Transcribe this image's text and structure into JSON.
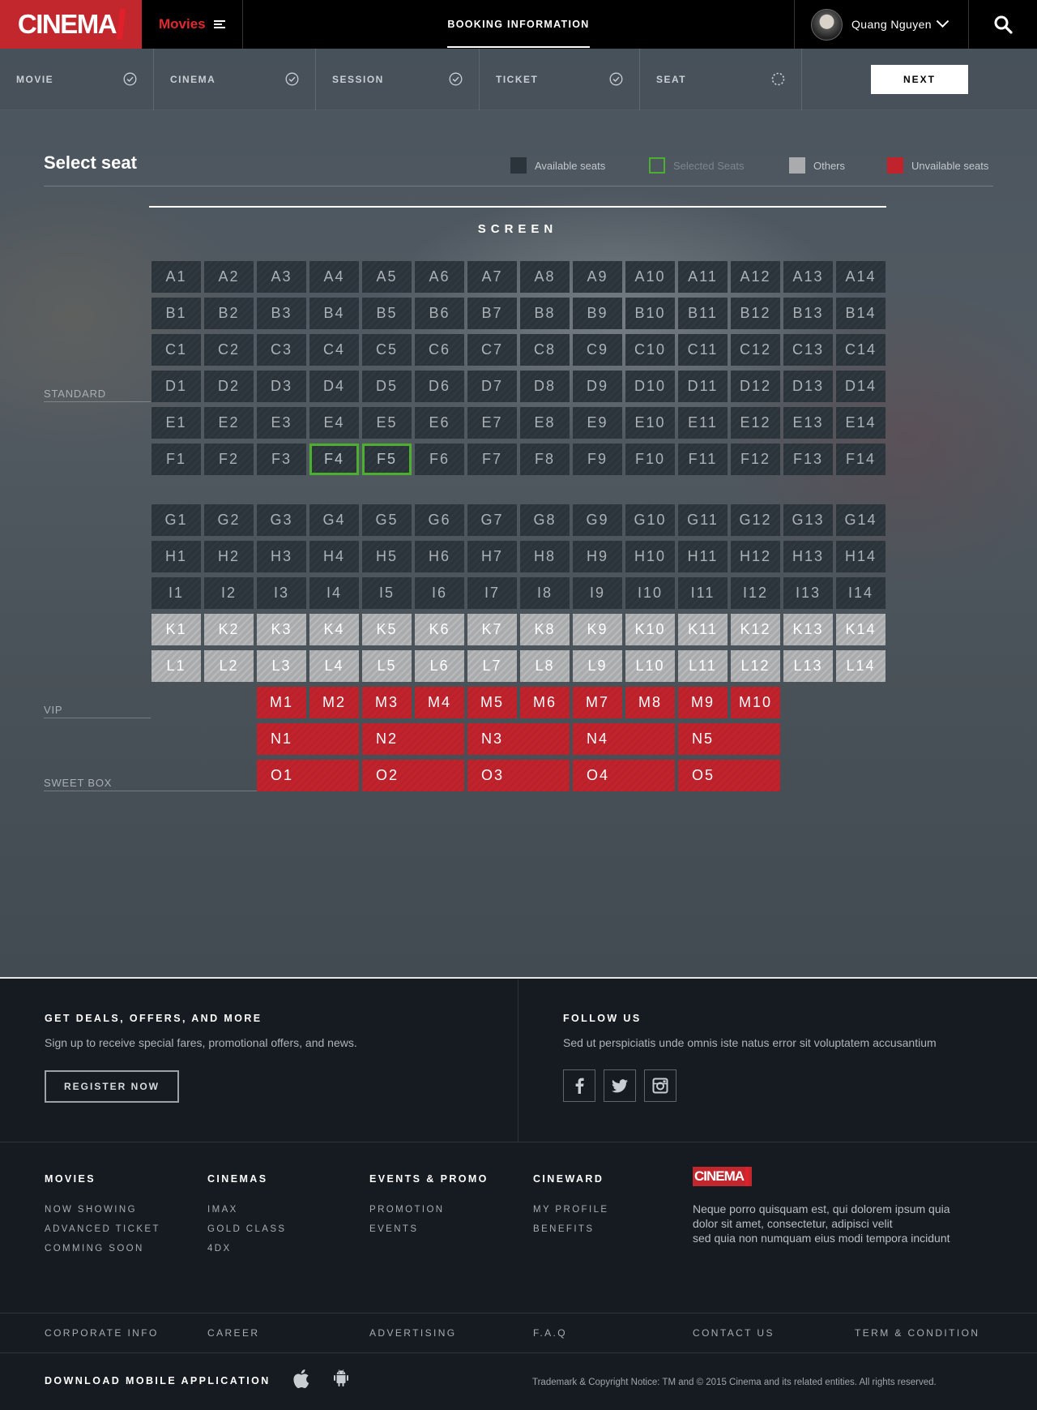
{
  "brand": {
    "logo_text": "CINEMA"
  },
  "topbar": {
    "movies_label": "Movies",
    "nav_title": "BOOKING INFORMATION",
    "user_name": "Quang Nguyen",
    "icons": {
      "menu": "hamburger-icon",
      "dropdown": "chevron-down-icon",
      "search": "search-icon"
    }
  },
  "steps": {
    "items": [
      {
        "label": "MOVIE",
        "status": "done"
      },
      {
        "label": "CINEMA",
        "status": "done"
      },
      {
        "label": "SESSION",
        "status": "done"
      },
      {
        "label": "TICKET",
        "status": "done"
      },
      {
        "label": "SEAT",
        "status": "in-progress"
      }
    ],
    "next_label": "NEXT"
  },
  "seat_map": {
    "title": "Select seat",
    "legend": [
      {
        "label": "Available seats",
        "color": "#2c343b"
      },
      {
        "label": "Selected Seats",
        "color": "#4caf2f"
      },
      {
        "label": "Others",
        "color": "#a9abad"
      },
      {
        "label": "Unvailable seats",
        "color": "#c1232d"
      }
    ],
    "screen_label": "SCREEN",
    "sections": {
      "standard": "STANDARD",
      "vip": "VIP",
      "sweetbox": "SWEET BOX"
    },
    "standard_rows": [
      "A",
      "B",
      "C",
      "D",
      "E",
      "F"
    ],
    "vip_rows_available": [
      "G",
      "H",
      "I"
    ],
    "vip_rows_others": [
      "K",
      "L"
    ],
    "row_count": 14,
    "selected": [
      "F4",
      "F5"
    ],
    "unavailable_row": {
      "row": "M",
      "count": 10
    },
    "sweetbox_rows": [
      {
        "row": "N",
        "count": 5
      },
      {
        "row": "O",
        "count": 5
      }
    ]
  },
  "footer": {
    "deals": {
      "heading": "GET DEALS, OFFERS, AND MORE",
      "text": "Sign up to receive special fares, promotional offers, and news.",
      "button": "REGISTER NOW"
    },
    "follow": {
      "heading": "FOLLOW US",
      "text": "Sed ut perspiciatis unde omnis iste natus error sit voluptatem accusantium",
      "icons": [
        "facebook-icon",
        "twitter-icon",
        "instagram-icon"
      ]
    },
    "columns": [
      {
        "heading": "MOVIES",
        "links": [
          "NOW SHOWING",
          "ADVANCED TICKET",
          "COMMING SOON"
        ]
      },
      {
        "heading": "CINEMAS",
        "links": [
          "IMAX",
          "GOLD CLASS",
          "4DX"
        ]
      },
      {
        "heading": "EVENTS & PROMO",
        "links": [
          "PROMOTION",
          "EVENTS"
        ]
      },
      {
        "heading": "CINEWARD",
        "links": [
          "MY PROFILE",
          "BENEFITS"
        ]
      }
    ],
    "about": {
      "logo_text": "CINEMA",
      "lines": [
        "Neque porro quisquam est, qui dolorem ipsum quia",
        "dolor sit amet, consectetur, adipisci velit",
        "sed quia non numquam eius modi tempora incidunt"
      ]
    },
    "bottom_links": [
      "CORPORATE INFO",
      "CAREER",
      "ADVERTISING",
      "F.A.Q",
      "CONTACT US",
      "TERM & CONDITION"
    ],
    "download_label": "DOWNLOAD MOBILE APPLICATION",
    "app_icons": [
      "apple-icon",
      "android-icon"
    ],
    "copyright": "Trademark & Copyright Notice: TM and © 2015 Cinema and its related entities. All rights reserved."
  }
}
